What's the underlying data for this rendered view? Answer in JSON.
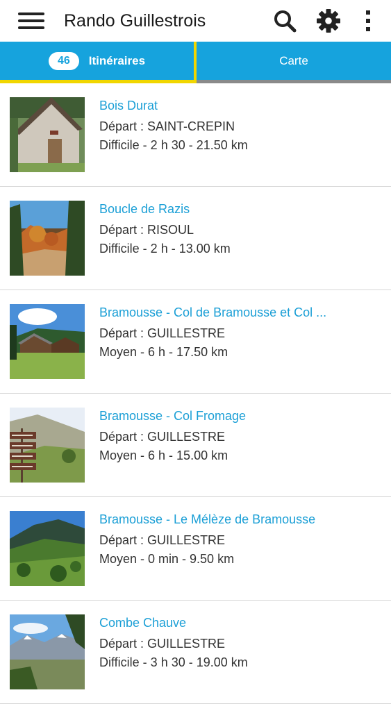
{
  "app": {
    "title": "Rando Guillestrois"
  },
  "tabs": {
    "itineraires": {
      "count": "46",
      "label": "Itinéraires"
    },
    "carte": {
      "label": "Carte"
    }
  },
  "items": [
    {
      "title": "Bois Durat",
      "depart": "Départ : SAINT-CREPIN",
      "details": "Difficile - 2 h 30 - 21.50 km"
    },
    {
      "title": "Boucle de Razis",
      "depart": "Départ : RISOUL",
      "details": "Difficile - 2 h - 13.00 km"
    },
    {
      "title": "Bramousse - Col de Bramousse et Col ...",
      "depart": "Départ : GUILLESTRE",
      "details": "Moyen - 6 h - 17.50 km"
    },
    {
      "title": "Bramousse - Col Fromage",
      "depart": "Départ : GUILLESTRE",
      "details": "Moyen - 6 h - 15.00 km"
    },
    {
      "title": "Bramousse - Le Mélèze de Bramousse",
      "depart": "Départ : GUILLESTRE",
      "details": "Moyen - 0 min - 9.50 km"
    },
    {
      "title": "Combe Chauve",
      "depart": "Départ : GUILLESTRE",
      "details": "Difficile - 3 h 30 - 19.00 km"
    }
  ],
  "colors": {
    "accent": "#16a3dd",
    "tab_indicator": "#f1d600",
    "link": "#1b9fd6"
  },
  "icons": {
    "menu": "hamburger-menu-icon",
    "search": "search-icon",
    "settings": "gear-icon",
    "more": "more-vert-icon"
  }
}
